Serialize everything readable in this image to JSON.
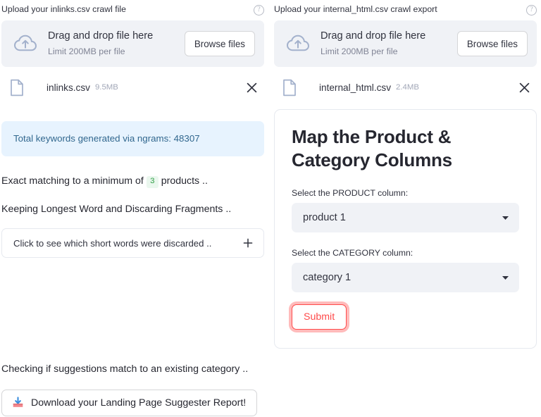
{
  "left": {
    "uploader": {
      "label": "Upload your inlinks.csv crawl file",
      "help_icon": "help-circle-icon",
      "dropzone": {
        "icon": "cloud-upload-icon",
        "title": "Drag and drop file here",
        "subtitle": "Limit 200MB per file",
        "browse_label": "Browse files"
      },
      "file": {
        "icon": "file-document-icon",
        "name": "inlinks.csv",
        "size": "9.5MB",
        "remove_icon": "close-icon"
      }
    },
    "info_box": {
      "text": "Total keywords generated via ngrams: 48307",
      "bg_color": "#e7f3fe",
      "text_color": "#31678e"
    },
    "paragraph_1": {
      "before": "Exact matching to a minimum of",
      "badge": "3",
      "after": "products ..",
      "badge_color": "#2f9e44",
      "badge_bg": "#eaf7ee"
    },
    "paragraph_2": "Keeping Longest Word and Discarding Fragments ..",
    "expander": {
      "label": "Click to see which short words were discarded ..",
      "icon": "plus-icon"
    }
  },
  "right": {
    "uploader": {
      "label": "Upload your internal_html.csv crawl export",
      "help_icon": "help-circle-icon",
      "dropzone": {
        "icon": "cloud-upload-icon",
        "title": "Drag and drop file here",
        "subtitle": "Limit 200MB per file",
        "browse_label": "Browse files"
      },
      "file": {
        "icon": "file-document-icon",
        "name": "internal_html.csv",
        "size": "2.4MB",
        "remove_icon": "close-icon"
      }
    },
    "card": {
      "title": "Map the Product & Category Columns",
      "product": {
        "label": "Select the PRODUCT column:",
        "value": "product 1",
        "caret_icon": "chevron-down-icon"
      },
      "category": {
        "label": "Select the CATEGORY column:",
        "value": "category 1",
        "caret_icon": "chevron-down-icon"
      },
      "submit_label": "Submit",
      "submit_color": "#ff4b4b"
    }
  },
  "bottom": {
    "status_text": "Checking if suggestions match to an existing category ..",
    "download": {
      "icon": "inbox-tray-emoji",
      "label": "Download your Landing Page Suggester Report!"
    }
  }
}
